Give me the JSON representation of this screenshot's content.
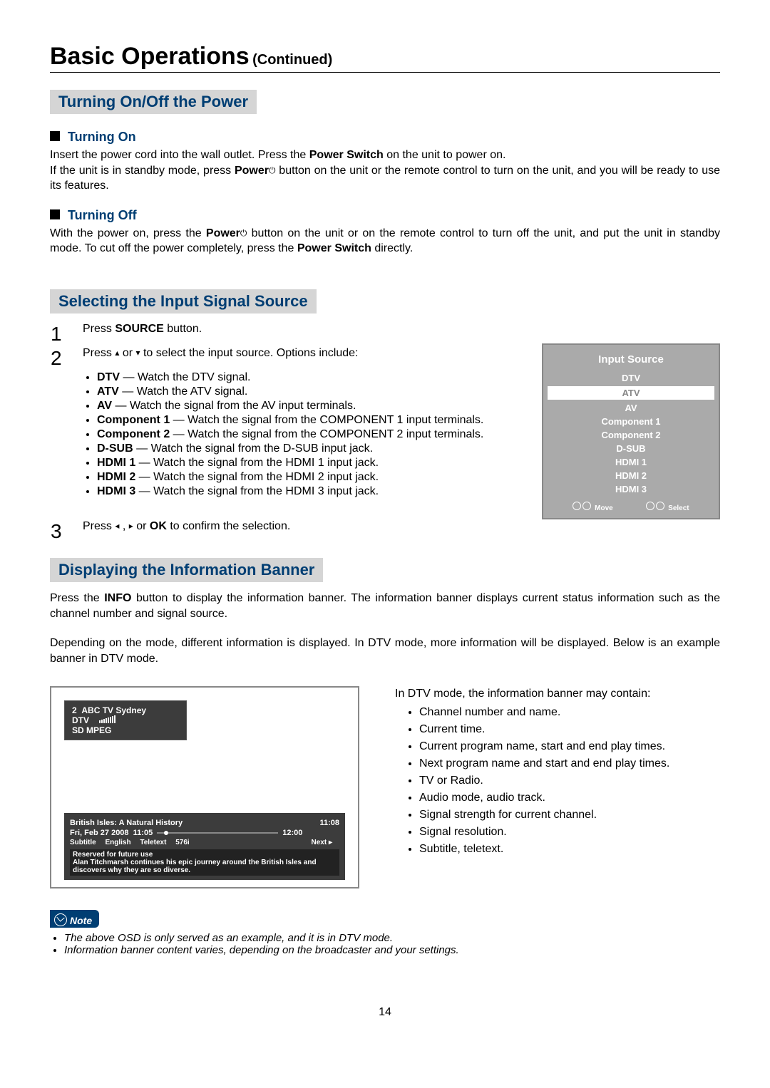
{
  "title": "Basic Operations",
  "title_cont": "(Continued)",
  "sections": {
    "power": {
      "heading": "Turning On/Off the Power",
      "on_heading": "Turning On",
      "on_text_a": "Insert the power cord into the wall outlet. Press the ",
      "on_text_b": "Power Switch",
      "on_text_c": " on the unit to power on.",
      "on_text2_a": "If the unit is in standby mode, press ",
      "on_text2_b": "Power",
      "on_text2_c": " button on the unit or the remote control to turn on the unit, and you will be ready to use its features.",
      "off_heading": "Turning Off",
      "off_text_a": "With the power on, press the ",
      "off_text_b": "Power",
      "off_text_c": " button on the unit or on the remote control to turn off the unit, and put the unit in standby mode. To cut off the power completely, press the ",
      "off_text_d": "Power Switch",
      "off_text_e": " directly."
    },
    "source": {
      "heading": "Selecting the Input Signal Source",
      "step1_a": "Press ",
      "step1_b": "SOURCE",
      "step1_c": " button.",
      "step2_a": "Press ",
      "step2_b": " or ",
      "step2_c": " to select the input source. Options include:",
      "options": [
        {
          "name": "DTV",
          "desc": "Watch the DTV signal."
        },
        {
          "name": "ATV",
          "desc": "Watch the ATV signal."
        },
        {
          "name": "AV",
          "desc": "Watch the signal from the AV input terminals."
        },
        {
          "name": "Component 1",
          "desc": "Watch the signal from the COMPONENT 1 input terminals."
        },
        {
          "name": "Component 2",
          "desc": "Watch the signal from the COMPONENT 2 input terminals."
        },
        {
          "name": "D-SUB",
          "desc": "Watch the signal from the D-SUB input jack."
        },
        {
          "name": "HDMI 1",
          "desc": "Watch the signal from the HDMI 1 input jack."
        },
        {
          "name": "HDMI 2",
          "desc": "Watch the signal from the HDMI 2 input jack."
        },
        {
          "name": "HDMI 3",
          "desc": "Watch the signal from the HDMI 3 input jack."
        }
      ],
      "step3_a": "Press ",
      "step3_b": " , ",
      "step3_c": " or ",
      "step3_d": "OK",
      "step3_e": " to confirm the selection.",
      "osd": {
        "title": "Input Source",
        "items": [
          "DTV",
          "ATV",
          "AV",
          "Component 1",
          "Component 2",
          "D-SUB",
          "HDMI 1",
          "HDMI 2",
          "HDMI 3"
        ],
        "selected_index": 1,
        "footer_move": "Move",
        "footer_select": "Select"
      }
    },
    "info": {
      "heading": "Displaying the Information Banner",
      "intro_a": "Press the ",
      "intro_b": "INFO",
      "intro_c": " button to display the information banner. The information banner displays current status information such as the channel number and signal source.",
      "intro2": "Depending on the mode, different information is displayed. In DTV mode, more information will be displayed. Below is an example banner in DTV mode.",
      "banner": {
        "ch_num": "2",
        "ch_name": "ABC TV Sydney",
        "mode": "DTV",
        "sd": "SD  MPEG",
        "prog_title": "British Isles: A Natural History",
        "time_now": "11:08",
        "date": "Fri, Feb 27 2008",
        "start": "11:05",
        "end": "12:00",
        "meta_subtitle": "Subtitle",
        "meta_lang": "English",
        "meta_teletext": "Teletext",
        "meta_res": "576i",
        "next": "Next ▸",
        "desc_title": "Reserved for future use",
        "desc_text": "Alan Titchmarsh continues his epic journey around the British Isles and discovers why they are so diverse."
      },
      "may_contain_intro": "In DTV mode, the information banner may contain:",
      "may_contain": [
        "Channel number and name.",
        "Current time.",
        "Current program name, start and end play times.",
        "Next program name and start and end play times.",
        "TV or Radio.",
        "Audio mode, audio track.",
        "Signal strength for current channel.",
        "Signal resolution.",
        "Subtitle, teletext."
      ]
    },
    "note": {
      "label": "Note",
      "items": [
        "The above OSD is only served as an example, and it is in DTV mode.",
        "Information banner content varies, depending on the broadcaster and your settings."
      ]
    }
  },
  "page_number": "14"
}
